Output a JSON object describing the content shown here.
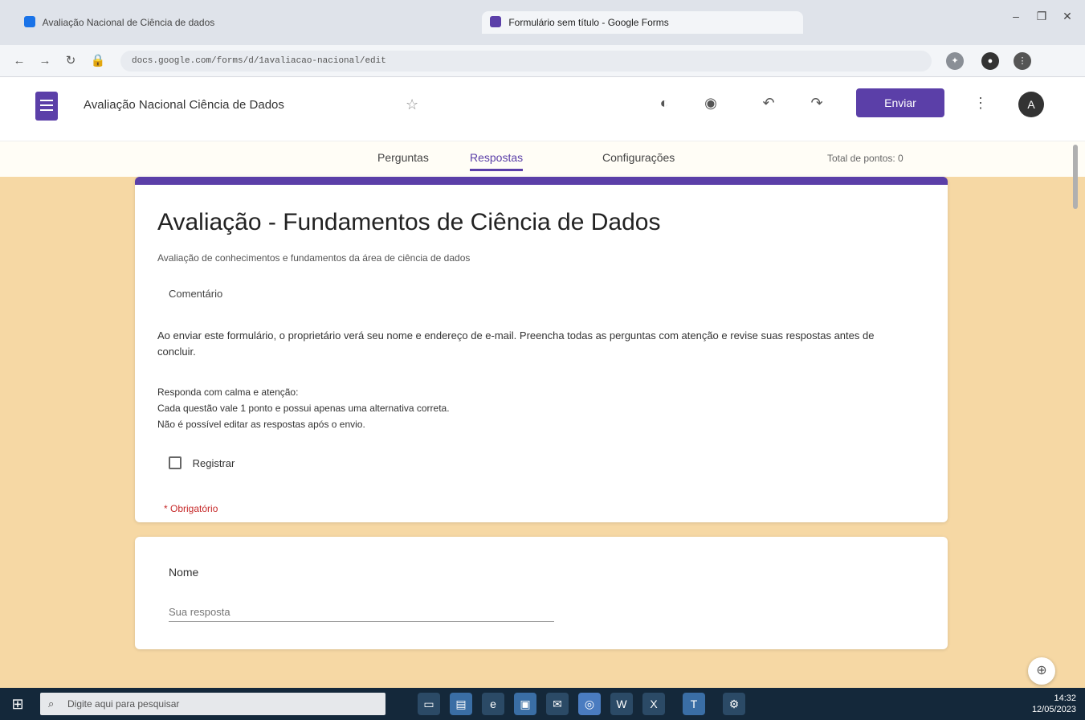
{
  "browser": {
    "tabs": [
      {
        "label": "Avaliação Nacional de Ciência de dados"
      },
      {
        "label": "Formulário sem título - Google Forms"
      }
    ],
    "url": "docs.google.com/forms/d/1avaliacao-nacional/edit",
    "window_controls": [
      "–",
      "❐",
      "✕"
    ]
  },
  "app": {
    "doc_title": "Avaliação Nacional Ciência de Dados",
    "send_label": "Enviar",
    "avatar_letter": "A"
  },
  "subtabs": {
    "items": [
      "Perguntas",
      "Respostas",
      "Configurações"
    ],
    "active": "Respostas",
    "response_count": "Total de pontos: 0"
  },
  "form": {
    "title": "Avaliação - Fundamentos de Ciência de Dados",
    "subtitle": "Avaliação de conhecimentos e fundamentos da área de ciência de dados",
    "email_label": "Comentário",
    "paragraph": "Ao enviar este formulário, o proprietário verá seu nome e endereço de e-mail. Preencha todas as perguntas com atenção e revise suas respostas antes de concluir.",
    "required_note_line1": "Responda com calma e atenção:",
    "required_note_line2": "Cada questão vale 1 ponto e possui apenas uma alternativa correta.",
    "required_note_line3": "Não é possível editar as respostas após o envio.",
    "record_label": "Registrar",
    "required_text": "* Obrigatório"
  },
  "question": {
    "label": "Nome",
    "placeholder": "Sua resposta"
  },
  "taskbar": {
    "search_placeholder": "Digite aqui para pesquisar",
    "time": "14:32",
    "date": "12/05/2023"
  }
}
